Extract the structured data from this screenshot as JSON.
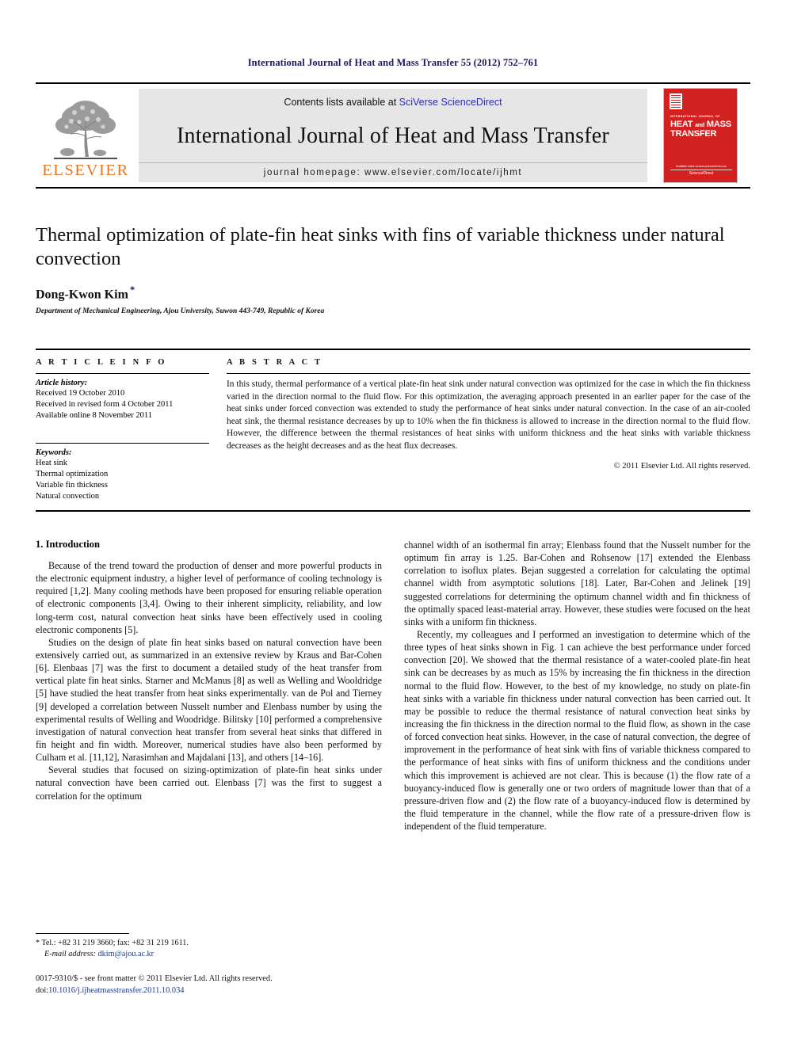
{
  "running_head": "International Journal of Heat and Mass Transfer 55 (2012) 752–761",
  "banner": {
    "publisher_name": "ELSEVIER",
    "contents_prefix": "Contents lists available at ",
    "contents_link": "SciVerse ScienceDirect",
    "journal_title": "International Journal of Heat and Mass Transfer",
    "homepage": "journal homepage: www.elsevier.com/locate/ijhmt",
    "cover": {
      "small_title": "INTERNATIONAL JOURNAL OF",
      "big_title_line1": "HEAT",
      "big_title_and": "and",
      "big_title_line1b": "MASS",
      "big_title_line2": "TRANSFER",
      "foot_note": "Available online at www.sciencedirect.com",
      "foot_brand": "ScienceDirect"
    }
  },
  "article": {
    "title": "Thermal optimization of plate-fin heat sinks with fins of variable thickness under natural convection",
    "author": "Dong-Kwon Kim",
    "author_marker": "*",
    "affiliation": "Department of Mechanical Engineering, Ajou University, Suwon 443-749, Republic of Korea"
  },
  "article_info": {
    "heading": "A R T I C L E   I N F O",
    "history_label": "Article history:",
    "history": [
      "Received 19 October 2010",
      "Received in revised form 4 October 2011",
      "Available online 8 November 2011"
    ],
    "keywords_label": "Keywords:",
    "keywords": [
      "Heat sink",
      "Thermal optimization",
      "Variable fin thickness",
      "Natural convection"
    ]
  },
  "abstract": {
    "heading": "A B S T R A C T",
    "text": "In this study, thermal performance of a vertical plate-fin heat sink under natural convection was optimized for the case in which the fin thickness varied in the direction normal to the fluid flow. For this optimization, the averaging approach presented in an earlier paper for the case of the heat sinks under forced convection was extended to study the performance of heat sinks under natural convection. In the case of an air-cooled heat sink, the thermal resistance decreases by up to 10% when the fin thickness is allowed to increase in the direction normal to the fluid flow. However, the difference between the thermal resistances of heat sinks with uniform thickness and the heat sinks with variable thickness decreases as the height decreases and as the heat flux decreases.",
    "copyright": "© 2011 Elsevier Ltd. All rights reserved."
  },
  "body": {
    "section_title": "1. Introduction",
    "left_paragraphs": [
      "Because of the trend toward the production of denser and more powerful products in the electronic equipment industry, a higher level of performance of cooling technology is required [1,2]. Many cooling methods have been proposed for ensuring reliable operation of electronic components [3,4]. Owing to their inherent simplicity, reliability, and low long-term cost, natural convection heat sinks have been effectively used in cooling electronic components [5].",
      "Studies on the design of plate fin heat sinks based on natural convection have been extensively carried out, as summarized in an extensive review by Kraus and Bar-Cohen [6]. Elenbaas [7] was the first to document a detailed study of the heat transfer from vertical plate fin heat sinks. Starner and McManus [8] as well as Welling and Wooldridge [5] have studied the heat transfer from heat sinks experimentally. van de Pol and Tierney [9] developed a correlation between Nusselt number and Elenbass number by using the experimental results of Welling and Woodridge. Bilitsky [10] performed a comprehensive investigation of natural convection heat transfer from several heat sinks that differed in fin height and fin width. Moreover, numerical studies have also been performed by Culham et al. [11,12], Narasimhan and Majdalani [13], and others [14–16].",
      "Several studies that focused on sizing-optimization of plate-fin heat sinks under natural convection have been carried out. Elenbass [7] was the first to suggest a correlation for the optimum"
    ],
    "right_paragraphs": [
      "channel width of an isothermal fin array; Elenbass found that the Nusselt number for the optimum fin array is 1.25. Bar-Cohen and Rohsenow [17] extended the Elenbass correlation to isoflux plates. Bejan suggested a correlation for calculating the optimal channel width from asymptotic solutions [18]. Later, Bar-Cohen and Jelinek [19] suggested correlations for determining the optimum channel width and fin thickness of the optimally spaced least-material array. However, these studies were focused on the heat sinks with a uniform fin thickness.",
      "Recently, my colleagues and I performed an investigation to determine which of the three types of heat sinks shown in Fig. 1 can achieve the best performance under forced convection [20]. We showed that the thermal resistance of a water-cooled plate-fin heat sink can be decreases by as much as 15% by increasing the fin thickness in the direction normal to the fluid flow. However, to the best of my knowledge, no study on plate-fin heat sinks with a variable fin thickness under natural convection has been carried out. It may be possible to reduce the thermal resistance of natural convection heat sinks by increasing the fin thickness in the direction normal to the fluid flow, as shown in the case of forced convection heat sinks. However, in the case of natural convection, the degree of improvement in the performance of heat sink with fins of variable thickness compared to the performance of heat sinks with fins of uniform thickness and the conditions under which this improvement is achieved are not clear. This is because (1) the flow rate of a buoyancy-induced flow is generally one or two orders of magnitude lower than that of a pressure-driven flow and (2) the flow rate of a buoyancy-induced flow is determined by the fluid temperature in the channel, while the flow rate of a pressure-driven flow is independent of the fluid temperature."
    ]
  },
  "footnote": {
    "marker": "*",
    "contact": "Tel.: +82 31 219 3660; fax: +82 31 219 1611.",
    "email_label": "E-mail address:",
    "email": "dkim@ajou.ac.kr"
  },
  "footer": {
    "issn_line": "0017-9310/$ - see front matter © 2011 Elsevier Ltd. All rights reserved.",
    "doi_prefix": "doi:",
    "doi": "10.1016/j.ijheatmasstransfer.2011.10.034"
  }
}
